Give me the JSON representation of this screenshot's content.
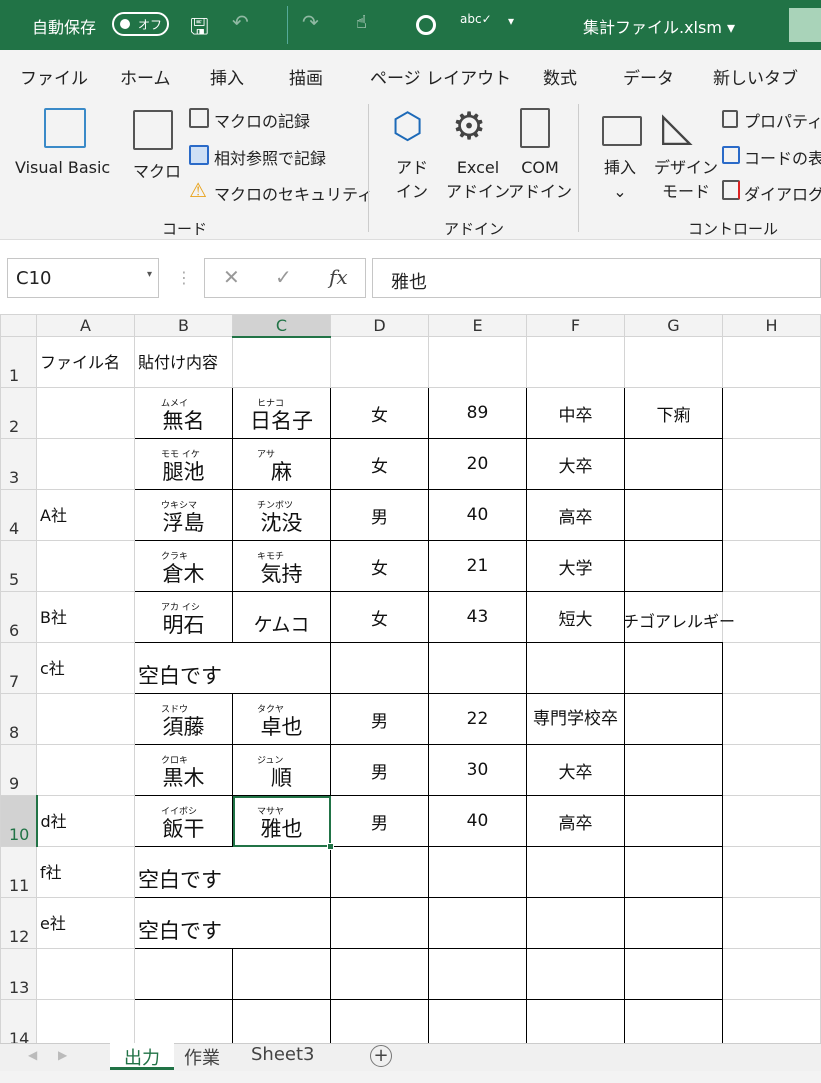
{
  "titlebar": {
    "autosave": "自動保存",
    "toggle": "オフ",
    "filename": "集計ファイル.xlsm ▾",
    "accent": "#217346"
  },
  "menu": [
    "ファイル",
    "ホーム",
    "挿入",
    "描画",
    "ページ レイアウト",
    "数式",
    "データ",
    "新しいタブ"
  ],
  "ribbon": {
    "visual_basic": "Visual Basic",
    "macro": "マクロ",
    "record": "マクロの記録",
    "relative": "相対参照で記録",
    "security": "マクロのセキュリティ",
    "group_code": "コード",
    "addin1": "アド",
    "addin2": "イン",
    "excel1": "Excel",
    "excel2": "アドイン",
    "com1": "COM",
    "com2": "アドイン",
    "group_addin": "アドイン",
    "insert": "挿入",
    "design1": "デザイン",
    "design2": "モード",
    "properties": "プロパティ",
    "viewcode": "コードの表",
    "dialog": "ダイアログの",
    "group_control": "コントロール"
  },
  "formula": {
    "namebox": "C10",
    "fx": "fx",
    "value": "雅也"
  },
  "columns": [
    "A",
    "B",
    "C",
    "D",
    "E",
    "F",
    "G",
    "H"
  ],
  "rows": [
    {
      "n": "1",
      "cells": [
        {
          "t": "ファイル名"
        },
        {
          "t": "貼付け内容"
        },
        {},
        {},
        {},
        {},
        {},
        {}
      ]
    },
    {
      "n": "2",
      "cells": [
        {},
        {
          "r": "ムメイ",
          "t": "無名"
        },
        {
          "r": "ヒナコ",
          "t": "日名子"
        },
        {
          "t": "女"
        },
        {
          "t": "89"
        },
        {
          "t": "中卒"
        },
        {
          "t": "下痢"
        },
        {}
      ]
    },
    {
      "n": "3",
      "cells": [
        {},
        {
          "r": "モモ イケ",
          "t": "腿池"
        },
        {
          "r": "アサ",
          "t": "麻"
        },
        {
          "t": "女"
        },
        {
          "t": "20"
        },
        {
          "t": "大卒"
        },
        {},
        {}
      ]
    },
    {
      "n": "4",
      "cells": [
        {
          "t": "A社"
        },
        {
          "r": "ウキシマ",
          "t": "浮島"
        },
        {
          "r": "チンボツ",
          "t": "沈没"
        },
        {
          "t": "男"
        },
        {
          "t": "40"
        },
        {
          "t": "高卒"
        },
        {},
        {}
      ]
    },
    {
      "n": "5",
      "cells": [
        {},
        {
          "r": "クラキ",
          "t": "倉木"
        },
        {
          "r": "キモチ",
          "t": "気持"
        },
        {
          "t": "女"
        },
        {
          "t": "21"
        },
        {
          "t": "大学"
        },
        {},
        {}
      ]
    },
    {
      "n": "6",
      "cells": [
        {
          "t": "B社"
        },
        {
          "r": "アカ イシ",
          "t": "明石"
        },
        {
          "t": "ケムコ"
        },
        {
          "t": "女"
        },
        {
          "t": "43"
        },
        {
          "t": "短大"
        },
        {
          "t": "チゴアレルギー"
        },
        {}
      ]
    },
    {
      "n": "7",
      "cells": [
        {
          "t": "c社"
        },
        {
          "t": "空白です"
        },
        {},
        {},
        {},
        {},
        {},
        {}
      ]
    },
    {
      "n": "8",
      "cells": [
        {},
        {
          "r": "スドウ",
          "t": "須藤"
        },
        {
          "r": "タクヤ",
          "t": "卓也"
        },
        {
          "t": "男"
        },
        {
          "t": "22"
        },
        {
          "t": "専門学校卒"
        },
        {},
        {}
      ]
    },
    {
      "n": "9",
      "cells": [
        {},
        {
          "r": "クロキ",
          "t": "黒木"
        },
        {
          "r": "ジュン",
          "t": "順"
        },
        {
          "t": "男"
        },
        {
          "t": "30"
        },
        {
          "t": "大卒"
        },
        {},
        {}
      ]
    },
    {
      "n": "10",
      "cells": [
        {
          "t": "d社"
        },
        {
          "r": "イイボシ",
          "t": "飯干"
        },
        {
          "r": "マサヤ",
          "t": "雅也"
        },
        {
          "t": "男"
        },
        {
          "t": "40"
        },
        {
          "t": "高卒"
        },
        {},
        {}
      ]
    },
    {
      "n": "11",
      "cells": [
        {
          "t": "f社"
        },
        {
          "t": "空白です"
        },
        {},
        {},
        {},
        {},
        {},
        {}
      ]
    },
    {
      "n": "12",
      "cells": [
        {
          "t": "e社"
        },
        {
          "t": "空白です"
        },
        {},
        {},
        {},
        {},
        {},
        {}
      ]
    },
    {
      "n": "13",
      "cells": [
        {},
        {},
        {},
        {},
        {},
        {},
        {},
        {}
      ]
    },
    {
      "n": "14",
      "cells": [
        {},
        {},
        {},
        {},
        {},
        {},
        {},
        {}
      ]
    }
  ],
  "selected_cell": "C10",
  "sheets": [
    {
      "label": "出力",
      "active": true
    },
    {
      "label": "作業"
    },
    {
      "label": "Sheet3"
    }
  ],
  "add_sheet": "+"
}
